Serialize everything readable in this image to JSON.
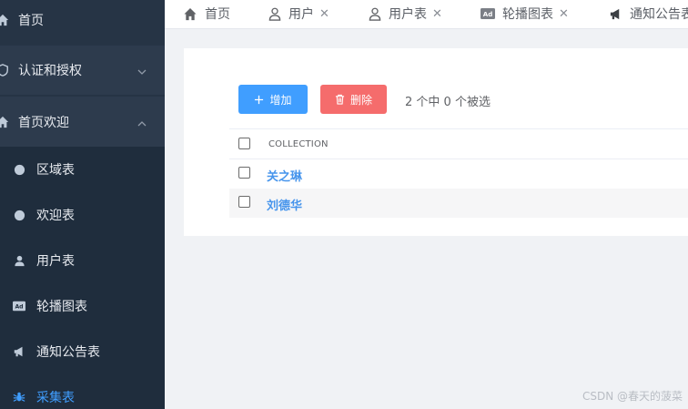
{
  "sidebar": {
    "items": [
      {
        "label": "首页",
        "icon": "home-icon"
      },
      {
        "label": "认证和授权",
        "icon": "shield-icon",
        "expanded": false
      },
      {
        "label": "首页欢迎",
        "icon": "home-icon",
        "expanded": true
      },
      {
        "label": "区域表",
        "icon": "circle-icon"
      },
      {
        "label": "欢迎表",
        "icon": "circle-icon"
      },
      {
        "label": "用户表",
        "icon": "user-icon"
      },
      {
        "label": "轮播图表",
        "icon": "ad-icon"
      },
      {
        "label": "通知公告表",
        "icon": "bullhorn-icon"
      },
      {
        "label": "采集表",
        "icon": "spider-icon",
        "active": true
      }
    ],
    "active_color": "#409eff"
  },
  "tabs": [
    {
      "label": "首页",
      "icon": "home-icon",
      "closable": false
    },
    {
      "label": "用户",
      "icon": "user-icon",
      "closable": true
    },
    {
      "label": "用户表",
      "icon": "user-icon",
      "closable": true
    },
    {
      "label": "轮播图表",
      "icon": "ad-icon",
      "closable": true
    },
    {
      "label": "通知公告表",
      "icon": "bullhorn-icon",
      "closable": true
    }
  ],
  "toolbar": {
    "add_label": "增加",
    "delete_label": "删除",
    "selection_info": "2 个中 0 个被选"
  },
  "table": {
    "header": "COLLECTION",
    "rows": [
      {
        "name": "关之琳"
      },
      {
        "name": "刘德华"
      }
    ]
  },
  "watermark": "CSDN @春天的菠菜",
  "colors": {
    "primary": "#409eff",
    "danger": "#f56c6c",
    "sidebar_bg": "#263445",
    "link": "#4795ec"
  }
}
